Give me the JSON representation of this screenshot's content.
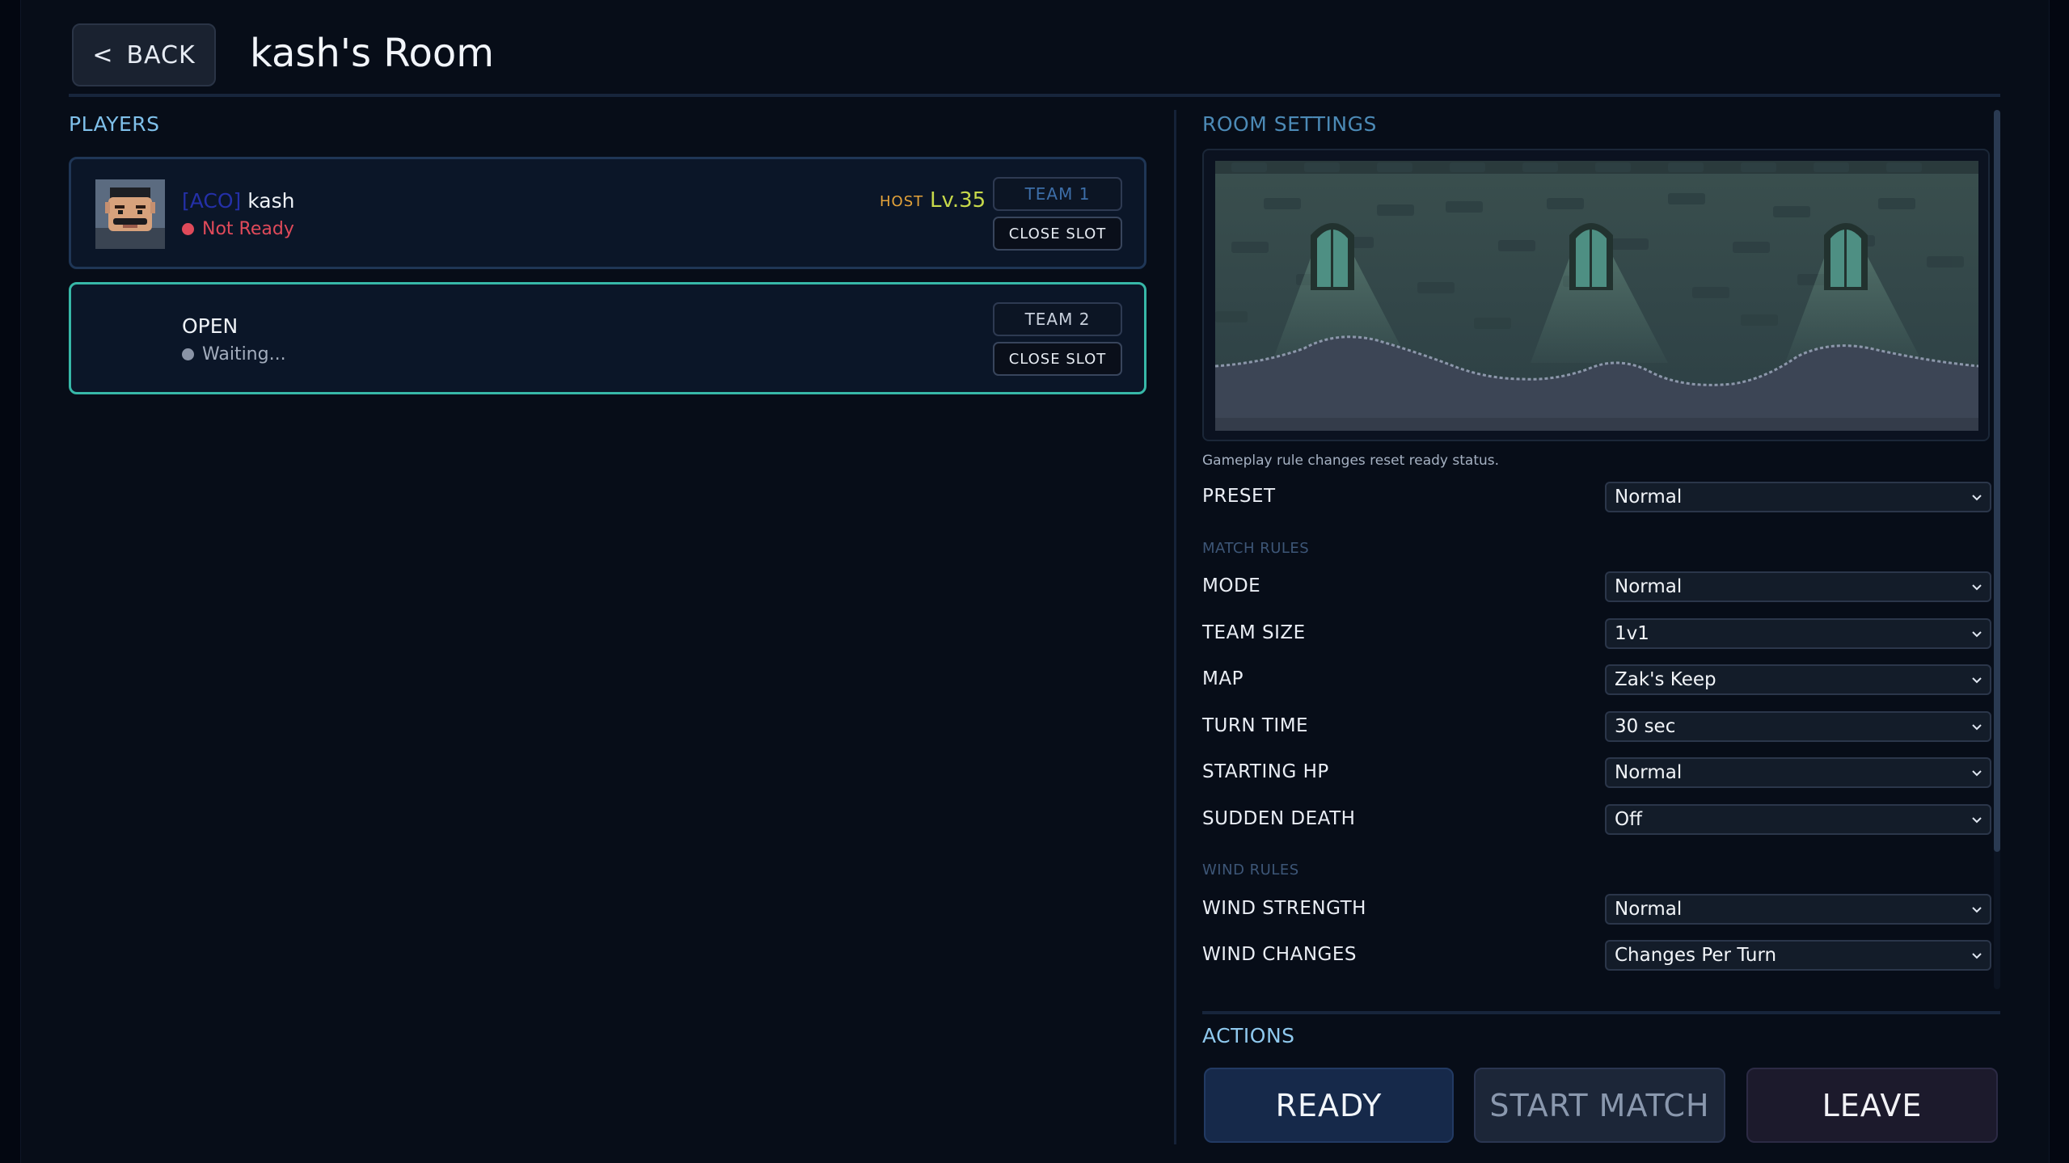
{
  "header": {
    "back_label": "BACK",
    "room_title": "kash's Room"
  },
  "players": {
    "heading": "PLAYERS",
    "slots": [
      {
        "clan_tag": "[ACO]",
        "name": "kash",
        "status": "Not Ready",
        "status_color": "#e04a5a",
        "host_badge": "HOST",
        "level": "Lv.35",
        "team_label": "TEAM 1",
        "team_color": "#3d6ea8",
        "close_label": "CLOSE SLOT"
      },
      {
        "name": "OPEN",
        "status": "Waiting...",
        "status_color": "#8a94a6",
        "team_label": "TEAM 2",
        "team_color": "#c8d0dc",
        "close_label": "CLOSE SLOT"
      }
    ]
  },
  "settings": {
    "heading": "ROOM SETTINGS",
    "note": "Gameplay rule changes reset ready status.",
    "preset": {
      "label": "PRESET",
      "value": "Normal"
    },
    "match_rules_label": "MATCH RULES",
    "mode": {
      "label": "MODE",
      "value": "Normal"
    },
    "team_size": {
      "label": "TEAM SIZE",
      "value": "1v1"
    },
    "map": {
      "label": "MAP",
      "value": "Zak's Keep"
    },
    "turn_time": {
      "label": "TURN TIME",
      "value": "30 sec"
    },
    "starting_hp": {
      "label": "STARTING HP",
      "value": "Normal"
    },
    "sudden_death": {
      "label": "SUDDEN DEATH",
      "value": "Off"
    },
    "wind_rules_label": "WIND RULES",
    "wind_strength": {
      "label": "WIND STRENGTH",
      "value": "Normal"
    },
    "wind_changes": {
      "label": "WIND CHANGES",
      "value": "Changes Per Turn"
    }
  },
  "actions": {
    "heading": "ACTIONS",
    "ready_label": "READY",
    "start_label": "START MATCH",
    "leave_label": "LEAVE"
  }
}
